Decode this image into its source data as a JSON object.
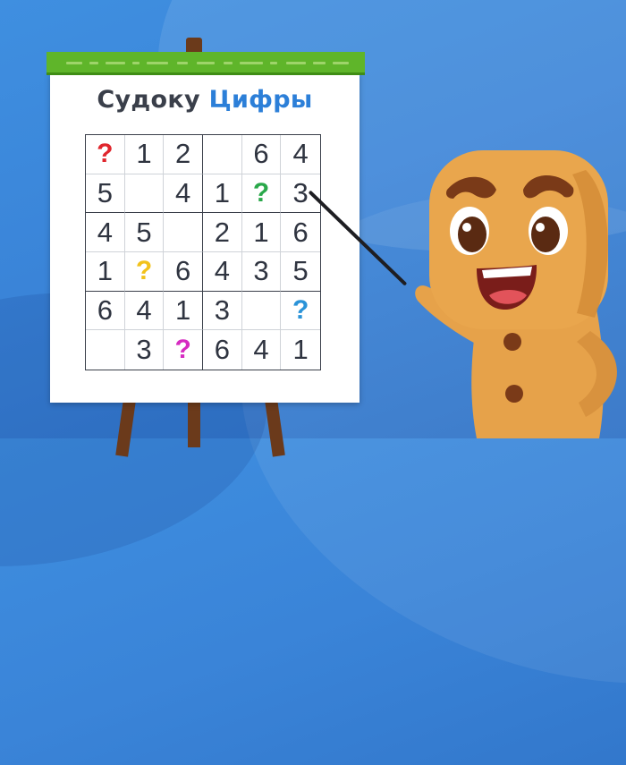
{
  "title": {
    "part1": "Судоку",
    "part2": "Цифры"
  },
  "colors": {
    "title_dark": "#3a3f4a",
    "title_blue": "#2c7fd8",
    "question_red": "#e0262d",
    "question_green": "#2aa84a",
    "question_yellow": "#f2c21b",
    "question_blue": "#2a93d8",
    "question_magenta": "#d62bc1",
    "board_bar": "#5fb52a"
  },
  "grid": {
    "rows": [
      [
        "?",
        "1",
        "2",
        "",
        "6",
        "4"
      ],
      [
        "5",
        "",
        "4",
        "1",
        "?",
        "3"
      ],
      [
        "4",
        "5",
        "",
        "2",
        "1",
        "6"
      ],
      [
        "1",
        "?",
        "6",
        "4",
        "3",
        "5"
      ],
      [
        "6",
        "4",
        "1",
        "3",
        "",
        "?"
      ],
      [
        "",
        "3",
        "?",
        "6",
        "4",
        "1"
      ]
    ],
    "question_colors": {
      "0-0": "#e0262d",
      "1-4": "#2aa84a",
      "3-1": "#f2c21b",
      "4-5": "#2a93d8",
      "5-2": "#d62bc1"
    }
  },
  "character": {
    "icon": "cookie-character-icon"
  },
  "easel": {
    "icon": "easel-icon"
  }
}
